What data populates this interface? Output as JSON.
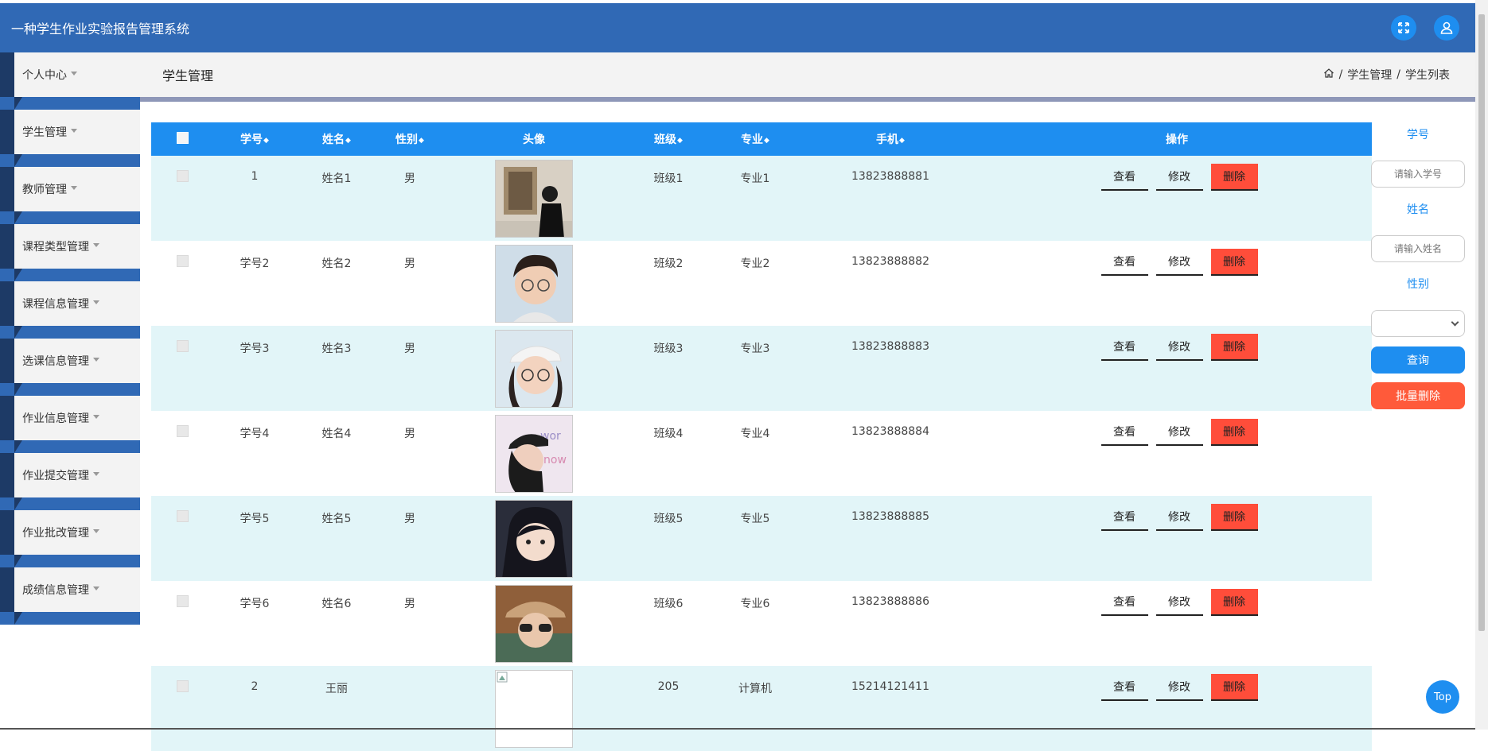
{
  "app": {
    "title": "一种学生作业实验报告管理系统"
  },
  "sidebar": {
    "items": [
      {
        "label": "个人中心"
      },
      {
        "label": "学生管理"
      },
      {
        "label": "教师管理"
      },
      {
        "label": "课程类型管理"
      },
      {
        "label": "课程信息管理"
      },
      {
        "label": "选课信息管理"
      },
      {
        "label": "作业信息管理"
      },
      {
        "label": "作业提交管理"
      },
      {
        "label": "作业批改管理"
      },
      {
        "label": "成绩信息管理"
      }
    ]
  },
  "page": {
    "title": "学生管理",
    "breadcrumb": [
      "学生管理",
      "学生列表"
    ],
    "breadcrumb_sep": "/"
  },
  "table": {
    "columns": [
      "学号",
      "姓名",
      "性别",
      "头像",
      "班级",
      "专业",
      "手机",
      "操作"
    ],
    "sort_glyph": "◆",
    "actions": {
      "view": "查看",
      "edit": "修改",
      "delete": "删除"
    },
    "rows": [
      {
        "id": "1",
        "name": "姓名1",
        "gender": "男",
        "class": "班级1",
        "major": "专业1",
        "phone": "13823888881"
      },
      {
        "id": "学号2",
        "name": "姓名2",
        "gender": "男",
        "class": "班级2",
        "major": "专业2",
        "phone": "13823888882"
      },
      {
        "id": "学号3",
        "name": "姓名3",
        "gender": "男",
        "class": "班级3",
        "major": "专业3",
        "phone": "13823888883"
      },
      {
        "id": "学号4",
        "name": "姓名4",
        "gender": "男",
        "class": "班级4",
        "major": "专业4",
        "phone": "13823888884"
      },
      {
        "id": "学号5",
        "name": "姓名5",
        "gender": "男",
        "class": "班级5",
        "major": "专业5",
        "phone": "13823888885"
      },
      {
        "id": "学号6",
        "name": "姓名6",
        "gender": "男",
        "class": "班级6",
        "major": "专业6",
        "phone": "13823888886"
      },
      {
        "id": "2",
        "name": "王丽",
        "gender": "",
        "class": "205",
        "major": "计算机",
        "phone": "15214121411"
      }
    ]
  },
  "filter": {
    "id_label": "学号",
    "id_placeholder": "请输入学号",
    "name_label": "姓名",
    "name_placeholder": "请输入姓名",
    "gender_label": "性别",
    "gender_value": "",
    "query": "查询",
    "batch_delete": "批量删除"
  },
  "top_button": "Top",
  "colors": {
    "header": "#3069b5",
    "accent": "#1e8ef0",
    "danger": "#ff4d3a",
    "row_alt": "#e2f5f8"
  }
}
